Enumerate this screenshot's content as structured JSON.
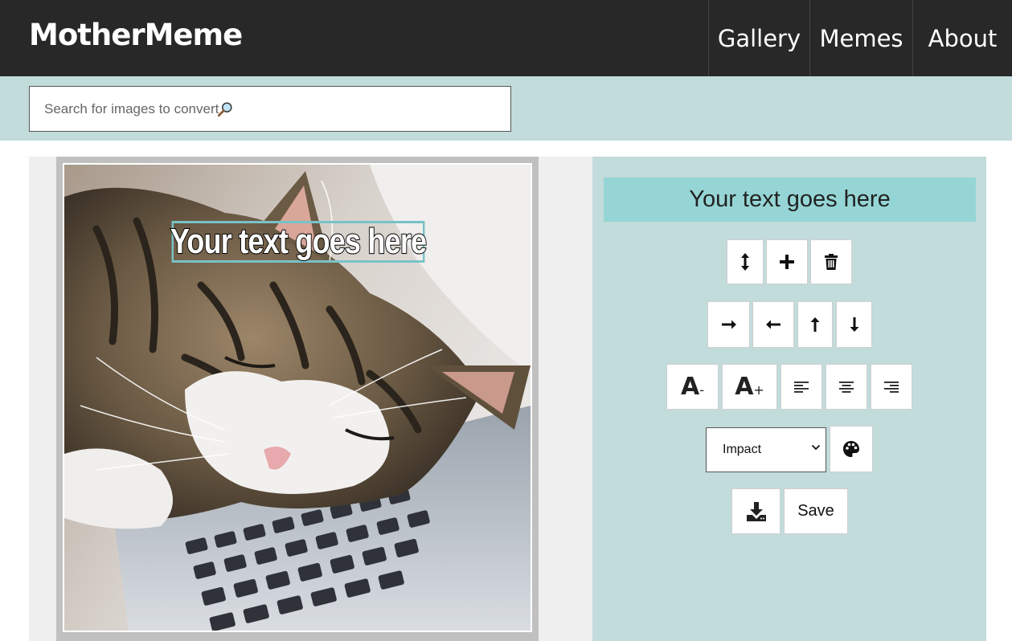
{
  "header": {
    "logo": "MotherMeme",
    "nav": [
      {
        "label": "Gallery"
      },
      {
        "label": "Memes"
      },
      {
        "label": "About"
      }
    ]
  },
  "search": {
    "placeholder": "Search for images to convert",
    "icon": "magnifier-icon"
  },
  "canvas": {
    "meme_text": "Your text goes here",
    "image": "sleeping-cat-on-laptop"
  },
  "editor": {
    "text_value": "Your text goes here",
    "buttons": {
      "resize_vertical": "arrows-vertical-icon",
      "add_text": "plus-icon",
      "delete_text": "trash-icon",
      "move_right": "arrow-right-icon",
      "move_left": "arrow-left-icon",
      "move_up": "arrow-up-icon",
      "move_down": "arrow-down-icon",
      "font_decrease_label": "A",
      "font_decrease_suffix": "-",
      "font_increase_label": "A",
      "font_increase_suffix": "+",
      "align_left": "align-left-icon",
      "align_center": "align-center-icon",
      "align_right": "align-right-icon",
      "color_picker": "palette-icon",
      "download": "download-icon",
      "save_label": "Save"
    },
    "font_select": {
      "selected": "Impact"
    }
  },
  "colors": {
    "header_bg": "#282828",
    "band_bg": "#c2dbdb",
    "text_field_bg": "#96d5d5",
    "selection_border": "#78c2c8"
  }
}
